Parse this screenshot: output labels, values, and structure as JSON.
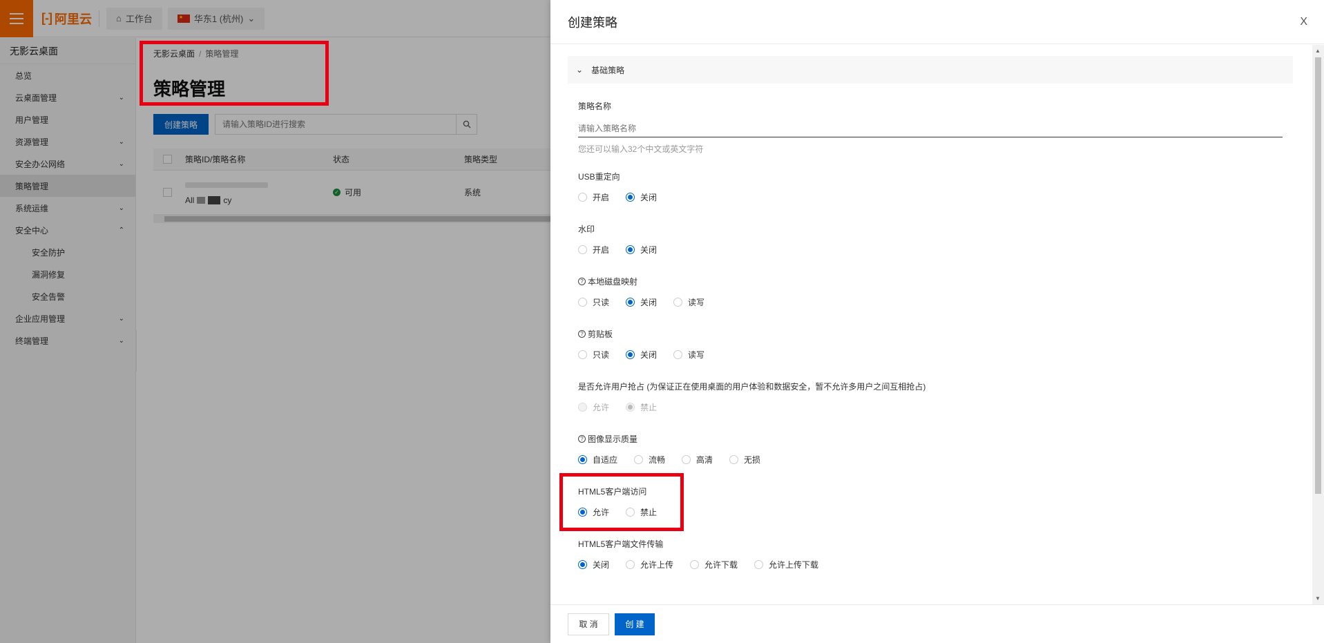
{
  "topbar": {
    "logo_text": "阿里云",
    "workbench_label": "工作台",
    "region_label": "华东1 (杭州)"
  },
  "sidebar": {
    "title": "无影云桌面",
    "items": [
      {
        "label": "总览"
      },
      {
        "label": "云桌面管理"
      },
      {
        "label": "用户管理"
      },
      {
        "label": "资源管理"
      },
      {
        "label": "安全办公网络"
      },
      {
        "label": "策略管理"
      },
      {
        "label": "系统运维"
      },
      {
        "label": "安全中心"
      },
      {
        "label": "安全防护"
      },
      {
        "label": "漏洞修复"
      },
      {
        "label": "安全告警"
      },
      {
        "label": "企业应用管理"
      },
      {
        "label": "终端管理"
      }
    ]
  },
  "main": {
    "breadcrumb": {
      "root": "无影云桌面",
      "sep": "/",
      "current": "策略管理"
    },
    "title": "策略管理",
    "create_button": "创建策略",
    "search_placeholder": "请输入策略ID进行搜索",
    "table": {
      "headers": [
        "策略ID/策略名称",
        "状态",
        "策略类型"
      ],
      "rows": [
        {
          "name_prefix": "All",
          "name_suffix": "cy",
          "status": "可用",
          "type": "系统"
        }
      ]
    }
  },
  "drawer": {
    "title": "创建策略",
    "close": "X",
    "section_title": "基础策略",
    "policy_name": {
      "label": "策略名称",
      "placeholder": "请输入策略名称",
      "hint": "您还可以输入32个中文或英文字符"
    },
    "fields": {
      "usb": {
        "label": "USB重定向",
        "options": [
          "开启",
          "关闭"
        ]
      },
      "watermark": {
        "label": "水印",
        "options": [
          "开启",
          "关闭"
        ]
      },
      "disk": {
        "label": "本地磁盘映射",
        "options": [
          "只读",
          "关闭",
          "读写"
        ]
      },
      "clipboard": {
        "label": "剪贴板",
        "options": [
          "只读",
          "关闭",
          "读写"
        ]
      },
      "preempt": {
        "label": "是否允许用户抢占 (为保证正在使用桌面的用户体验和数据安全，暂不允许多用户之间互相抢占)",
        "options": [
          "允许",
          "禁止"
        ]
      },
      "quality": {
        "label": "图像显示质量",
        "options": [
          "自适应",
          "流畅",
          "高清",
          "无损"
        ]
      },
      "html5_access": {
        "label": "HTML5客户端访问",
        "options": [
          "允许",
          "禁止"
        ]
      },
      "html5_transfer": {
        "label": "HTML5客户端文件传输",
        "options": [
          "关闭",
          "允许上传",
          "允许下载",
          "允许上传下载"
        ]
      }
    },
    "cancel_button": "取 消",
    "create_button": "创 建"
  },
  "colors": {
    "accent": "#0064c8",
    "brand": "#ff6a00",
    "highlight": "#e60012"
  }
}
